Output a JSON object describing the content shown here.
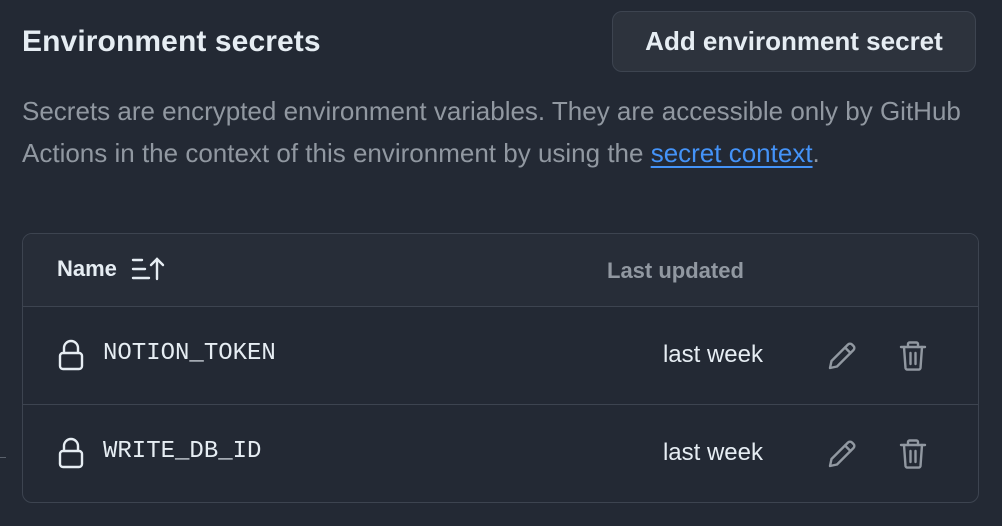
{
  "header": {
    "title": "Environment secrets",
    "add_button_label": "Add environment secret"
  },
  "description": {
    "text_before_link": "Secrets are encrypted environment variables. They are accessible only by GitHub Actions in the context of this environment by using the ",
    "link_text": "secret context",
    "text_after_link": "."
  },
  "table": {
    "columns": {
      "name": "Name",
      "last_updated": "Last updated"
    },
    "rows": [
      {
        "name": "NOTION_TOKEN",
        "last_updated": "last week"
      },
      {
        "name": "WRITE_DB_ID",
        "last_updated": "last week"
      }
    ]
  },
  "icons": {
    "sort": "sort-ascending-icon",
    "lock": "lock-icon",
    "edit": "pencil-icon",
    "delete": "trash-icon"
  },
  "colors": {
    "background": "#232934",
    "border": "#3d4450",
    "text_primary": "#e6edf3",
    "text_muted": "#9198a1",
    "link": "#4493f8"
  }
}
